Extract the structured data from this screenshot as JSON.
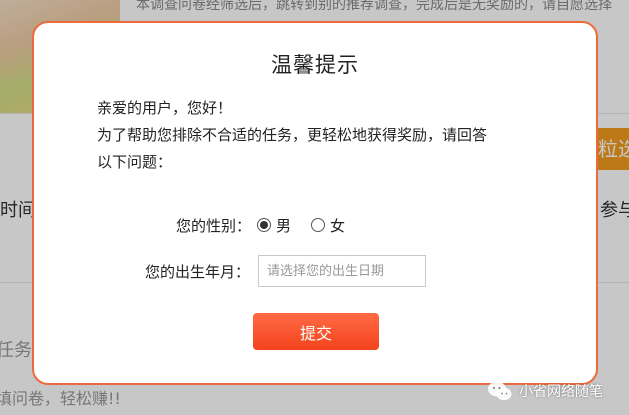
{
  "background": {
    "top_text": "本调查问卷经筛选后，跳转到别的推荐调查，完成后是无奖励的，请自愿选择",
    "orange_tag": "粒选",
    "left_label": "时间:",
    "right_label": "参与人",
    "left_label_2": "任务",
    "bottom_text": "填问卷，轻松赚!!"
  },
  "dialog": {
    "title": "温馨提示",
    "body_lines": [
      "亲爱的用户，您好！",
      "为了帮助您排除不合适的任务，更轻松地获得奖励，请回答",
      "以下问题："
    ],
    "gender": {
      "label": "您的性别：",
      "options": [
        {
          "label": "男",
          "checked": true
        },
        {
          "label": "女",
          "checked": false
        }
      ]
    },
    "birth": {
      "label": "您的出生年月：",
      "value": "",
      "placeholder": "请选择您的出生日期"
    },
    "submit_label": "提交"
  },
  "watermark": {
    "text": "小省网络随笔",
    "icon": "wechat-icon"
  },
  "colors": {
    "dialog_border": "#ec6a3c",
    "button_top": "#ff6a45",
    "button_bottom": "#f4431d",
    "orange_tag": "#f39a1e"
  }
}
